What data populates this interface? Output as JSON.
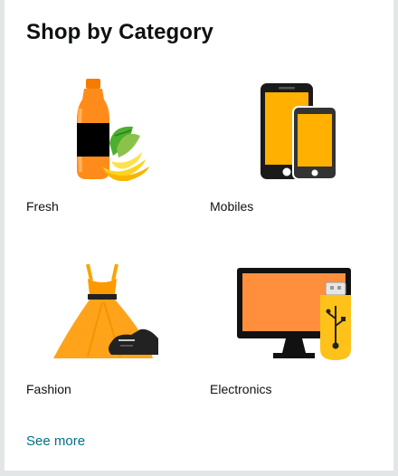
{
  "card": {
    "title": "Shop by Category",
    "categories": [
      {
        "label": "Fresh",
        "icon": "fresh-icon"
      },
      {
        "label": "Mobiles",
        "icon": "mobile-phones-icon"
      },
      {
        "label": "Fashion",
        "icon": "dress-and-shoe-icon"
      },
      {
        "label": "Electronics",
        "icon": "monitor-and-usb-icon"
      }
    ],
    "see_more": "See more"
  },
  "colors": {
    "link": "#007185",
    "accent_orange": "#f7a600",
    "background": "#e3e6e6"
  }
}
